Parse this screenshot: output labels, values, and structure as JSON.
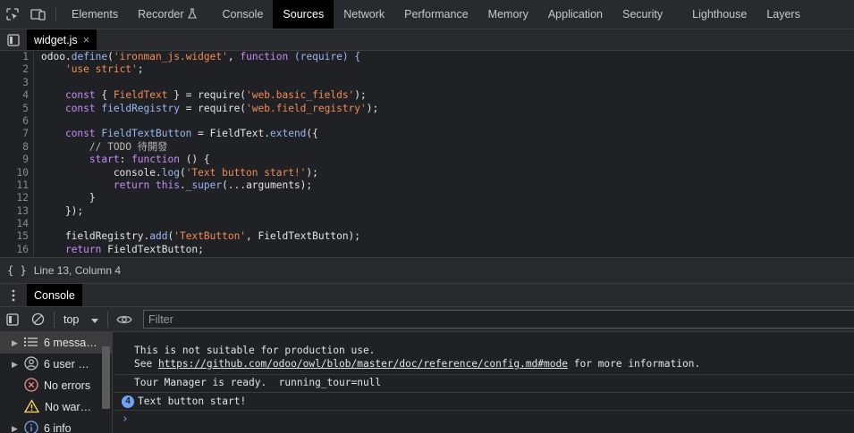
{
  "devtools": {
    "tabs": [
      {
        "label": "Elements"
      },
      {
        "label": "Recorder"
      },
      {
        "label": "Console"
      },
      {
        "label": "Sources"
      },
      {
        "label": "Network"
      },
      {
        "label": "Performance"
      },
      {
        "label": "Memory"
      },
      {
        "label": "Application"
      },
      {
        "label": "Security"
      },
      {
        "label": "Lighthouse"
      },
      {
        "label": "Layers"
      }
    ],
    "active_tab": "Sources"
  },
  "editor": {
    "file_tab": "widget.js",
    "close_glyph": "×",
    "lines": [
      {
        "n": "1",
        "tokens": [
          {
            "t": "odoo",
            "c": ""
          },
          {
            "t": ".",
            "c": ""
          },
          {
            "t": "define",
            "c": "fn"
          },
          {
            "t": "(",
            "c": ""
          },
          {
            "t": "'ironman_js.widget'",
            "c": "str"
          },
          {
            "t": ", ",
            "c": ""
          },
          {
            "t": "function",
            "c": "kw"
          },
          {
            "t": " (require) {",
            "c": "fn"
          }
        ]
      },
      {
        "n": "2",
        "tokens": [
          {
            "t": "    ",
            "c": ""
          },
          {
            "t": "'use strict'",
            "c": "str"
          },
          {
            "t": ";",
            "c": ""
          }
        ]
      },
      {
        "n": "3",
        "tokens": [
          {
            "t": "",
            "c": ""
          }
        ]
      },
      {
        "n": "4",
        "tokens": [
          {
            "t": "    ",
            "c": ""
          },
          {
            "t": "const",
            "c": "kw"
          },
          {
            "t": " { ",
            "c": ""
          },
          {
            "t": "FieldText",
            "c": "str"
          },
          {
            "t": " } = require(",
            "c": ""
          },
          {
            "t": "'web.basic_fields'",
            "c": "str"
          },
          {
            "t": ");",
            "c": ""
          }
        ]
      },
      {
        "n": "5",
        "tokens": [
          {
            "t": "    ",
            "c": ""
          },
          {
            "t": "const",
            "c": "kw"
          },
          {
            "t": " ",
            "c": ""
          },
          {
            "t": "fieldRegistry",
            "c": "vr"
          },
          {
            "t": " = require(",
            "c": ""
          },
          {
            "t": "'web.field_registry'",
            "c": "str"
          },
          {
            "t": ");",
            "c": ""
          }
        ]
      },
      {
        "n": "6",
        "tokens": [
          {
            "t": "",
            "c": ""
          }
        ]
      },
      {
        "n": "7",
        "tokens": [
          {
            "t": "    ",
            "c": ""
          },
          {
            "t": "const",
            "c": "kw"
          },
          {
            "t": " ",
            "c": ""
          },
          {
            "t": "FieldTextButton",
            "c": "vr"
          },
          {
            "t": " = FieldText.",
            "c": ""
          },
          {
            "t": "extend",
            "c": "fn"
          },
          {
            "t": "({",
            "c": ""
          }
        ]
      },
      {
        "n": "8",
        "tokens": [
          {
            "t": "        ",
            "c": ""
          },
          {
            "t": "// TODO 待開發",
            "c": "cm"
          }
        ]
      },
      {
        "n": "9",
        "tokens": [
          {
            "t": "        ",
            "c": ""
          },
          {
            "t": "start",
            "c": "prop"
          },
          {
            "t": ": ",
            "c": ""
          },
          {
            "t": "function",
            "c": "kw"
          },
          {
            "t": " () {",
            "c": ""
          }
        ]
      },
      {
        "n": "10",
        "tokens": [
          {
            "t": "            console.",
            "c": ""
          },
          {
            "t": "log",
            "c": "fn"
          },
          {
            "t": "(",
            "c": ""
          },
          {
            "t": "'Text button start!'",
            "c": "str"
          },
          {
            "t": ");",
            "c": ""
          }
        ]
      },
      {
        "n": "11",
        "tokens": [
          {
            "t": "            ",
            "c": ""
          },
          {
            "t": "return",
            "c": "kw"
          },
          {
            "t": " ",
            "c": ""
          },
          {
            "t": "this",
            "c": "kw"
          },
          {
            "t": ".",
            "c": ""
          },
          {
            "t": "_super",
            "c": "fn"
          },
          {
            "t": "(...arguments);",
            "c": ""
          }
        ]
      },
      {
        "n": "12",
        "tokens": [
          {
            "t": "        }",
            "c": ""
          }
        ]
      },
      {
        "n": "13",
        "tokens": [
          {
            "t": "    });",
            "c": ""
          }
        ]
      },
      {
        "n": "14",
        "tokens": [
          {
            "t": "",
            "c": ""
          }
        ]
      },
      {
        "n": "15",
        "tokens": [
          {
            "t": "    fieldRegistry.",
            "c": ""
          },
          {
            "t": "add",
            "c": "fn"
          },
          {
            "t": "(",
            "c": ""
          },
          {
            "t": "'TextButton'",
            "c": "str"
          },
          {
            "t": ", FieldTextButton);",
            "c": ""
          }
        ]
      },
      {
        "n": "16",
        "tokens": [
          {
            "t": "    ",
            "c": ""
          },
          {
            "t": "return",
            "c": "kw"
          },
          {
            "t": " FieldTextButton;",
            "c": ""
          }
        ]
      }
    ]
  },
  "status_bar": {
    "brace_icon": "{ }",
    "position": "Line 13, Column 4"
  },
  "drawer": {
    "tab": "Console"
  },
  "console_toolbar": {
    "context": "top",
    "filter_placeholder": "Filter"
  },
  "console_sidebar": {
    "items": [
      {
        "label": "6 messa…",
        "icon": "list-icon"
      },
      {
        "label": "6 user …",
        "icon": "user-icon"
      },
      {
        "label": "No errors",
        "icon": "error-icon"
      },
      {
        "label": "No war…",
        "icon": "warning-icon"
      },
      {
        "label": "6 info",
        "icon": "info-icon"
      }
    ]
  },
  "console": {
    "msg1_line1": "This is not suitable for production use.",
    "msg1_see": "See ",
    "msg1_link": "https://github.com/odoo/owl/blob/master/doc/reference/config.md#mode",
    "msg1_tail": " for more information.",
    "msg2": "Tour Manager is ready.  running_tour=null",
    "msg3_count": "4",
    "msg3": "Text button start!",
    "prompt": "›"
  },
  "colors": {
    "accent_blue": "#6fa3f3",
    "string_orange": "#f28b54",
    "keyword_purple": "#c58af9",
    "error_red": "#f28b82",
    "warning_yellow": "#fdd663"
  }
}
